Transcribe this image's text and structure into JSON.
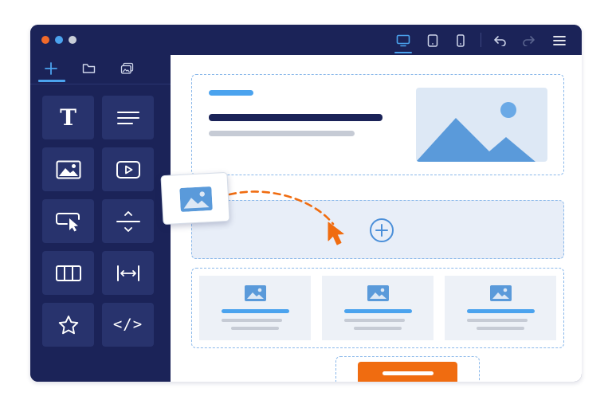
{
  "window": {
    "traffic_lights": [
      {
        "name": "close",
        "color": "#f26a2a"
      },
      {
        "name": "minimize",
        "color": "#4ba3ee"
      },
      {
        "name": "maximize",
        "color": "#c9ced8"
      }
    ],
    "device_views": [
      {
        "name": "desktop-view",
        "icon": "monitor-icon",
        "active": true
      },
      {
        "name": "tablet-view",
        "icon": "tablet-icon",
        "active": false
      },
      {
        "name": "mobile-view",
        "icon": "phone-icon",
        "active": false
      }
    ],
    "actions": [
      {
        "name": "undo",
        "icon": "undo-icon",
        "enabled": true
      },
      {
        "name": "redo",
        "icon": "redo-icon",
        "enabled": false
      },
      {
        "name": "menu",
        "icon": "hamburger-menu-icon",
        "enabled": true
      }
    ]
  },
  "sidebar": {
    "tabs": [
      {
        "name": "add-elements",
        "icon": "plus-icon",
        "active": true
      },
      {
        "name": "files",
        "icon": "folder-icon",
        "active": false
      },
      {
        "name": "assets",
        "icon": "images-icon",
        "active": false
      }
    ],
    "tools": [
      {
        "name": "text",
        "icon": "text-t-icon",
        "glyph": "T"
      },
      {
        "name": "paragraph",
        "icon": "paragraph-lines-icon"
      },
      {
        "name": "image",
        "icon": "image-icon"
      },
      {
        "name": "video",
        "icon": "video-play-icon"
      },
      {
        "name": "button",
        "icon": "button-cursor-icon"
      },
      {
        "name": "spacer",
        "icon": "spacer-icon"
      },
      {
        "name": "columns",
        "icon": "columns-icon"
      },
      {
        "name": "width",
        "icon": "width-arrows-icon"
      },
      {
        "name": "rating",
        "icon": "star-icon"
      },
      {
        "name": "code",
        "icon": "code-icon",
        "glyph": "</>"
      }
    ]
  },
  "colors": {
    "frame": "#1b2358",
    "tile": "#28336d",
    "accent_blue": "#4ba3ee",
    "accent_orange": "#f06c10",
    "dashed_border": "#8ab8ea",
    "drop_zone": "#e8eef8",
    "image_placeholder": "#dde8f5"
  },
  "canvas": {
    "drop_zone": {
      "icon": "add-circle-icon"
    },
    "hero": {
      "image_icon": "mountain-image-icon"
    },
    "cards": [
      {
        "name": "card-1",
        "icon": "image-icon"
      },
      {
        "name": "card-2",
        "icon": "image-icon"
      },
      {
        "name": "card-3",
        "icon": "image-icon"
      }
    ],
    "cta": {
      "name": "cta-button"
    }
  },
  "drag": {
    "item_icon": "image-icon",
    "cursor_icon": "cursor-arrow-icon"
  }
}
